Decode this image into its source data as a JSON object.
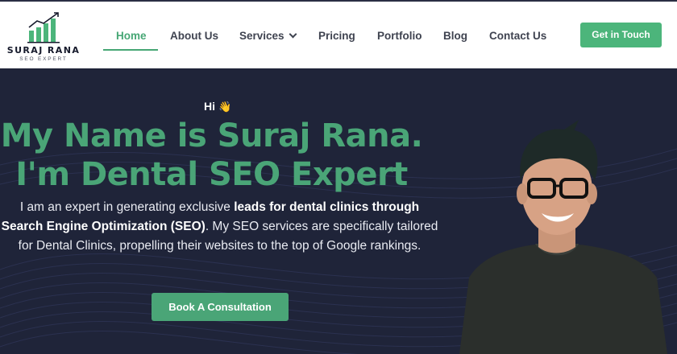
{
  "brand": {
    "name": "SURAJ RANA",
    "tagline": "SEO EXPERT",
    "logo_icon": "bar-chart-arrow-icon",
    "accent_color": "#47a775"
  },
  "nav": {
    "items": [
      {
        "label": "Home",
        "active": true
      },
      {
        "label": "About Us"
      },
      {
        "label": "Services",
        "has_dropdown": true
      },
      {
        "label": "Pricing"
      },
      {
        "label": "Portfolio"
      },
      {
        "label": "Blog"
      },
      {
        "label": "Contact Us"
      }
    ],
    "cta_label": "Get in Touch"
  },
  "hero": {
    "greeting": "Hi",
    "greeting_emoji": "👋",
    "headline_line1": "My Name is Suraj Rana.",
    "headline_line2": "I'm Dental SEO Expert",
    "desc_part1": "I am an expert in generating exclusive ",
    "desc_bold1": "leads for dental clinics through Search Engine Optimization (SEO)",
    "desc_part2": ". My SEO services are specifically tailored for Dental Clinics, propelling their websites to the top of Google rankings.",
    "button_label": "Book A Consultation",
    "background_color": "#1f2439"
  }
}
